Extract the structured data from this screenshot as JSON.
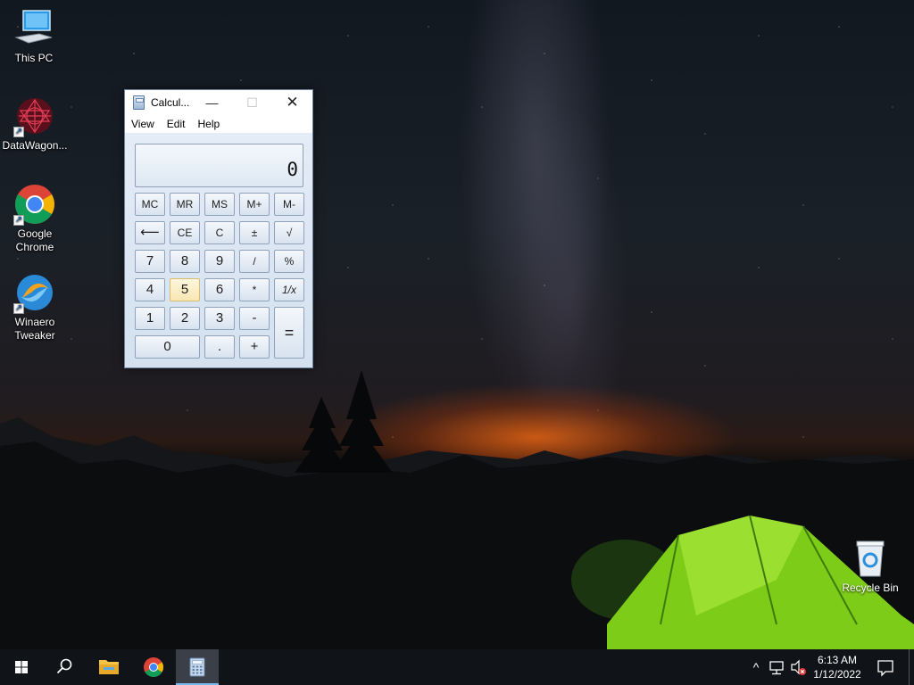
{
  "desktop": {
    "icons": [
      {
        "label": "This PC",
        "icon": "this-pc-icon"
      },
      {
        "label": "DataWagon...",
        "icon": "datawagon-icon"
      },
      {
        "label": "Google Chrome",
        "icon": "chrome-icon"
      },
      {
        "label": "Winaero Tweaker",
        "icon": "winaero-icon"
      }
    ],
    "recycle_bin": {
      "label": "Recycle Bin",
      "icon": "recycle-bin-icon"
    }
  },
  "calculator": {
    "title": "Calcul...",
    "window_controls": {
      "minimize": "—",
      "maximize": "☐",
      "close": "✕"
    },
    "menu": [
      "View",
      "Edit",
      "Help"
    ],
    "display": "0",
    "keys": {
      "mc": "MC",
      "mr": "MR",
      "ms": "MS",
      "mplus": "M+",
      "mminus": "M-",
      "backspace": "⟵",
      "ce": "CE",
      "c": "C",
      "plusminus": "±",
      "sqrt": "√",
      "seven": "7",
      "eight": "8",
      "nine": "9",
      "divide": "/",
      "percent": "%",
      "four": "4",
      "five": "5",
      "six": "6",
      "multiply": "*",
      "reciprocal": "1/x",
      "one": "1",
      "two": "2",
      "three": "3",
      "minus": "-",
      "equals": "=",
      "zero": "0",
      "decimal": ".",
      "plus": "+"
    }
  },
  "taskbar": {
    "start": "start-icon",
    "search": "search-icon",
    "pinned": [
      "file-explorer-icon",
      "chrome-icon",
      "calculator-icon"
    ],
    "tray": {
      "chevron": "^",
      "network": "network-icon",
      "volume": "volume-muted-icon"
    },
    "time": "6:13 AM",
    "date": "1/12/2022",
    "notifications": "notification-icon"
  },
  "colors": {
    "taskbar": "#101318",
    "accent": "#76b9ed",
    "calc_body": "#d9e4f1",
    "tent_green": "#7ccc18"
  }
}
